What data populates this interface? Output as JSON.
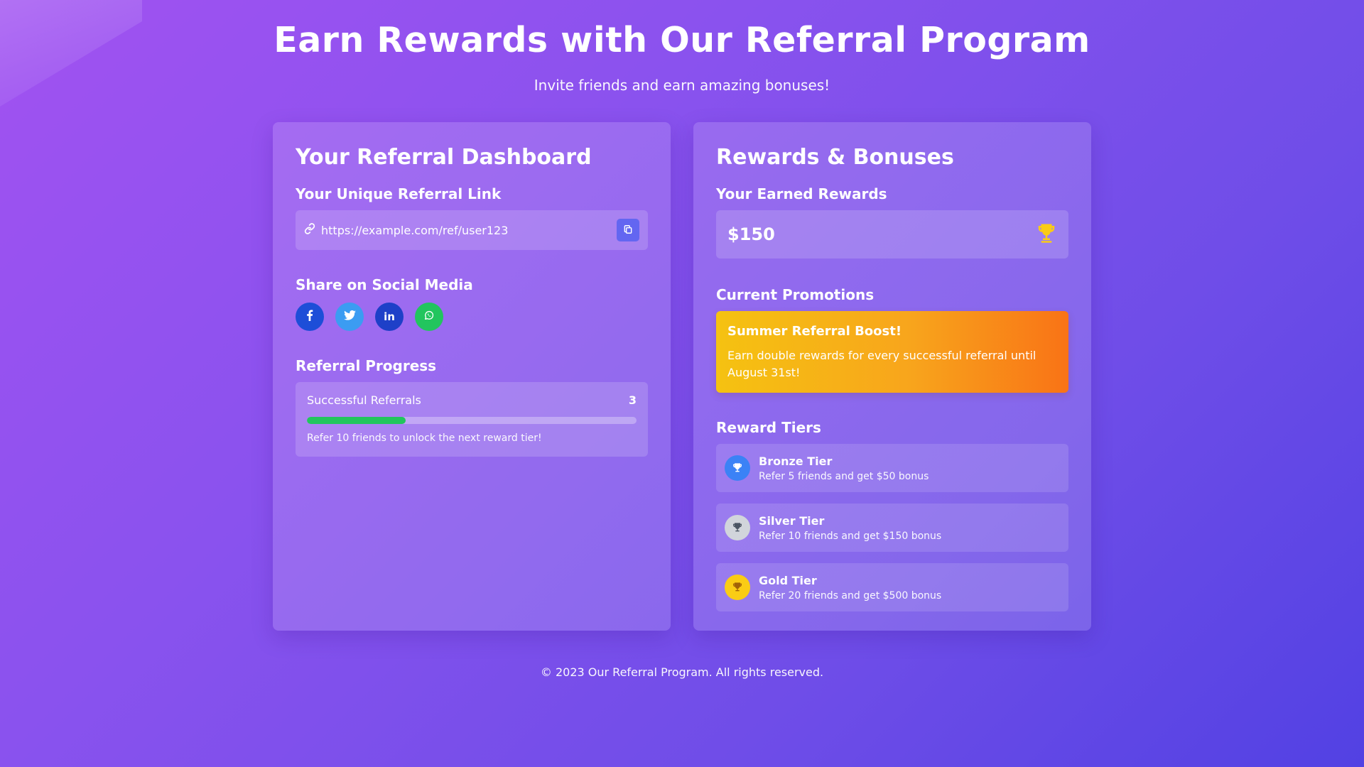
{
  "header": {
    "title": "Earn Rewards with Our Referral Program",
    "subtitle": "Invite friends and earn amazing bonuses!"
  },
  "dashboard": {
    "title": "Your Referral Dashboard",
    "link_section_title": "Your Unique Referral Link",
    "referral_link": "https://example.com/ref/user123",
    "share_section_title": "Share on Social Media",
    "social_buttons": [
      {
        "icon": "facebook-icon",
        "color": "#1d4ed8"
      },
      {
        "icon": "twitter-icon",
        "color": "#3b9cf2"
      },
      {
        "icon": "linkedin-icon",
        "color": "#1e40c8"
      },
      {
        "icon": "whatsapp-icon",
        "color": "#22c55e"
      }
    ],
    "progress_section_title": "Referral Progress",
    "progress_label": "Successful Referrals",
    "progress_count": "3",
    "progress_fraction": 0.3,
    "progress_note": "Refer 10 friends to unlock the next reward tier!"
  },
  "rewards": {
    "title": "Rewards & Bonuses",
    "earned_section_title": "Your Earned Rewards",
    "earned_amount": "$150",
    "promotions_section_title": "Current Promotions",
    "promotion": {
      "title": "Summer Referral Boost!",
      "text": "Earn double rewards for every successful referral until August 31st!"
    },
    "tiers_section_title": "Reward Tiers",
    "tiers": [
      {
        "name": "Bronze Tier",
        "desc": "Refer 5 friends and get $50 bonus",
        "color": "#3b82f6"
      },
      {
        "name": "Silver Tier",
        "desc": "Refer 10 friends and get $150 bonus",
        "color": "#d1d5db"
      },
      {
        "name": "Gold Tier",
        "desc": "Refer 20 friends and get $500 bonus",
        "color": "#facc15"
      }
    ]
  },
  "footer": {
    "text": "© 2023 Our Referral Program. All rights reserved."
  },
  "colors": {
    "accent": "#6366f1",
    "progress": "#22c55e",
    "trophy": "#facc15"
  }
}
